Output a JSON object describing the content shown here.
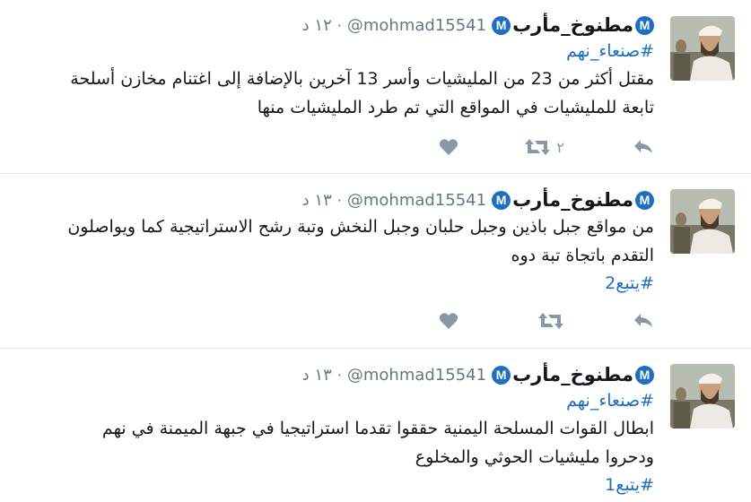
{
  "colors": {
    "accent": "#1b6fc2",
    "badge": "#1e6fc0",
    "muted": "#8899a6",
    "separator": "#e6ecf0"
  },
  "tweets": [
    {
      "badge": "M",
      "display_name": "مطنوخ_مأرب",
      "handle": "@mohmad15541",
      "time": "١٢ د",
      "hashtag": "#صنعاء_نهم",
      "lines": [
        "مقتل أكثر من 23 من المليشيات وأسر 13 آخرين بالإضافة إلى اغتنام مخازن أسلحة",
        "تابعة للمليشيات في المواقع التي تم طرد المليشيات منها"
      ],
      "trailing_hashtag": "",
      "retweet_count": "٢",
      "icons": {
        "reply": "reply-icon",
        "retweet": "retweet-icon",
        "like": "heart-icon"
      }
    },
    {
      "badge": "M",
      "display_name": "مطنوخ_مأرب",
      "handle": "@mohmad15541",
      "time": "١٣ د",
      "hashtag": "",
      "lines": [
        "من مواقع جبل باذين وجبل حلبان وجبل النخش وتبة رشح الاستراتيجية كما ويواصلون",
        "التقدم باتجاة تبة دوه"
      ],
      "trailing_hashtag": "#يتبع2",
      "retweet_count": "",
      "icons": {
        "reply": "reply-icon",
        "retweet": "retweet-icon",
        "like": "heart-icon"
      }
    },
    {
      "badge": "M",
      "display_name": "مطنوخ_مأرب",
      "handle": "@mohmad15541",
      "time": "١٣ د",
      "hashtag": "#صنعاء_نهم",
      "lines": [
        "ابطال القوات المسلحة اليمنية حققوا تقدما استراتيجيا في جبهة الميمنة في نهم",
        "ودحروا مليشيات الحوثي والمخلوع"
      ],
      "trailing_hashtag": "#يتبع1",
      "retweet_count": "",
      "icons": {
        "reply": "reply-icon",
        "retweet": "retweet-icon",
        "like": "heart-icon"
      }
    }
  ]
}
